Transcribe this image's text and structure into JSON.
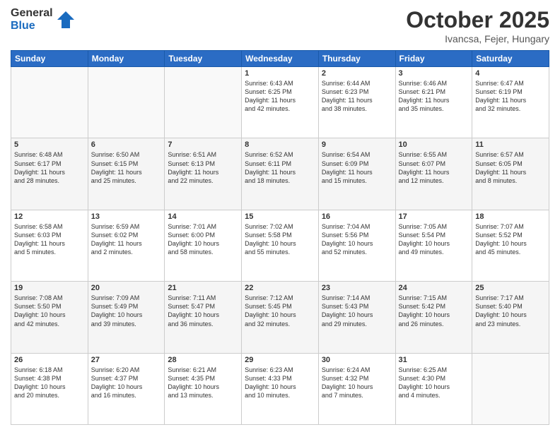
{
  "header": {
    "logo_general": "General",
    "logo_blue": "Blue",
    "title": "October 2025",
    "subtitle": "Ivancsa, Fejer, Hungary"
  },
  "weekdays": [
    "Sunday",
    "Monday",
    "Tuesday",
    "Wednesday",
    "Thursday",
    "Friday",
    "Saturday"
  ],
  "weeks": [
    [
      {
        "day": "",
        "info": ""
      },
      {
        "day": "",
        "info": ""
      },
      {
        "day": "",
        "info": ""
      },
      {
        "day": "1",
        "info": "Sunrise: 6:43 AM\nSunset: 6:25 PM\nDaylight: 11 hours\nand 42 minutes."
      },
      {
        "day": "2",
        "info": "Sunrise: 6:44 AM\nSunset: 6:23 PM\nDaylight: 11 hours\nand 38 minutes."
      },
      {
        "day": "3",
        "info": "Sunrise: 6:46 AM\nSunset: 6:21 PM\nDaylight: 11 hours\nand 35 minutes."
      },
      {
        "day": "4",
        "info": "Sunrise: 6:47 AM\nSunset: 6:19 PM\nDaylight: 11 hours\nand 32 minutes."
      }
    ],
    [
      {
        "day": "5",
        "info": "Sunrise: 6:48 AM\nSunset: 6:17 PM\nDaylight: 11 hours\nand 28 minutes."
      },
      {
        "day": "6",
        "info": "Sunrise: 6:50 AM\nSunset: 6:15 PM\nDaylight: 11 hours\nand 25 minutes."
      },
      {
        "day": "7",
        "info": "Sunrise: 6:51 AM\nSunset: 6:13 PM\nDaylight: 11 hours\nand 22 minutes."
      },
      {
        "day": "8",
        "info": "Sunrise: 6:52 AM\nSunset: 6:11 PM\nDaylight: 11 hours\nand 18 minutes."
      },
      {
        "day": "9",
        "info": "Sunrise: 6:54 AM\nSunset: 6:09 PM\nDaylight: 11 hours\nand 15 minutes."
      },
      {
        "day": "10",
        "info": "Sunrise: 6:55 AM\nSunset: 6:07 PM\nDaylight: 11 hours\nand 12 minutes."
      },
      {
        "day": "11",
        "info": "Sunrise: 6:57 AM\nSunset: 6:05 PM\nDaylight: 11 hours\nand 8 minutes."
      }
    ],
    [
      {
        "day": "12",
        "info": "Sunrise: 6:58 AM\nSunset: 6:03 PM\nDaylight: 11 hours\nand 5 minutes."
      },
      {
        "day": "13",
        "info": "Sunrise: 6:59 AM\nSunset: 6:02 PM\nDaylight: 11 hours\nand 2 minutes."
      },
      {
        "day": "14",
        "info": "Sunrise: 7:01 AM\nSunset: 6:00 PM\nDaylight: 10 hours\nand 58 minutes."
      },
      {
        "day": "15",
        "info": "Sunrise: 7:02 AM\nSunset: 5:58 PM\nDaylight: 10 hours\nand 55 minutes."
      },
      {
        "day": "16",
        "info": "Sunrise: 7:04 AM\nSunset: 5:56 PM\nDaylight: 10 hours\nand 52 minutes."
      },
      {
        "day": "17",
        "info": "Sunrise: 7:05 AM\nSunset: 5:54 PM\nDaylight: 10 hours\nand 49 minutes."
      },
      {
        "day": "18",
        "info": "Sunrise: 7:07 AM\nSunset: 5:52 PM\nDaylight: 10 hours\nand 45 minutes."
      }
    ],
    [
      {
        "day": "19",
        "info": "Sunrise: 7:08 AM\nSunset: 5:50 PM\nDaylight: 10 hours\nand 42 minutes."
      },
      {
        "day": "20",
        "info": "Sunrise: 7:09 AM\nSunset: 5:49 PM\nDaylight: 10 hours\nand 39 minutes."
      },
      {
        "day": "21",
        "info": "Sunrise: 7:11 AM\nSunset: 5:47 PM\nDaylight: 10 hours\nand 36 minutes."
      },
      {
        "day": "22",
        "info": "Sunrise: 7:12 AM\nSunset: 5:45 PM\nDaylight: 10 hours\nand 32 minutes."
      },
      {
        "day": "23",
        "info": "Sunrise: 7:14 AM\nSunset: 5:43 PM\nDaylight: 10 hours\nand 29 minutes."
      },
      {
        "day": "24",
        "info": "Sunrise: 7:15 AM\nSunset: 5:42 PM\nDaylight: 10 hours\nand 26 minutes."
      },
      {
        "day": "25",
        "info": "Sunrise: 7:17 AM\nSunset: 5:40 PM\nDaylight: 10 hours\nand 23 minutes."
      }
    ],
    [
      {
        "day": "26",
        "info": "Sunrise: 6:18 AM\nSunset: 4:38 PM\nDaylight: 10 hours\nand 20 minutes."
      },
      {
        "day": "27",
        "info": "Sunrise: 6:20 AM\nSunset: 4:37 PM\nDaylight: 10 hours\nand 16 minutes."
      },
      {
        "day": "28",
        "info": "Sunrise: 6:21 AM\nSunset: 4:35 PM\nDaylight: 10 hours\nand 13 minutes."
      },
      {
        "day": "29",
        "info": "Sunrise: 6:23 AM\nSunset: 4:33 PM\nDaylight: 10 hours\nand 10 minutes."
      },
      {
        "day": "30",
        "info": "Sunrise: 6:24 AM\nSunset: 4:32 PM\nDaylight: 10 hours\nand 7 minutes."
      },
      {
        "day": "31",
        "info": "Sunrise: 6:25 AM\nSunset: 4:30 PM\nDaylight: 10 hours\nand 4 minutes."
      },
      {
        "day": "",
        "info": ""
      }
    ]
  ]
}
